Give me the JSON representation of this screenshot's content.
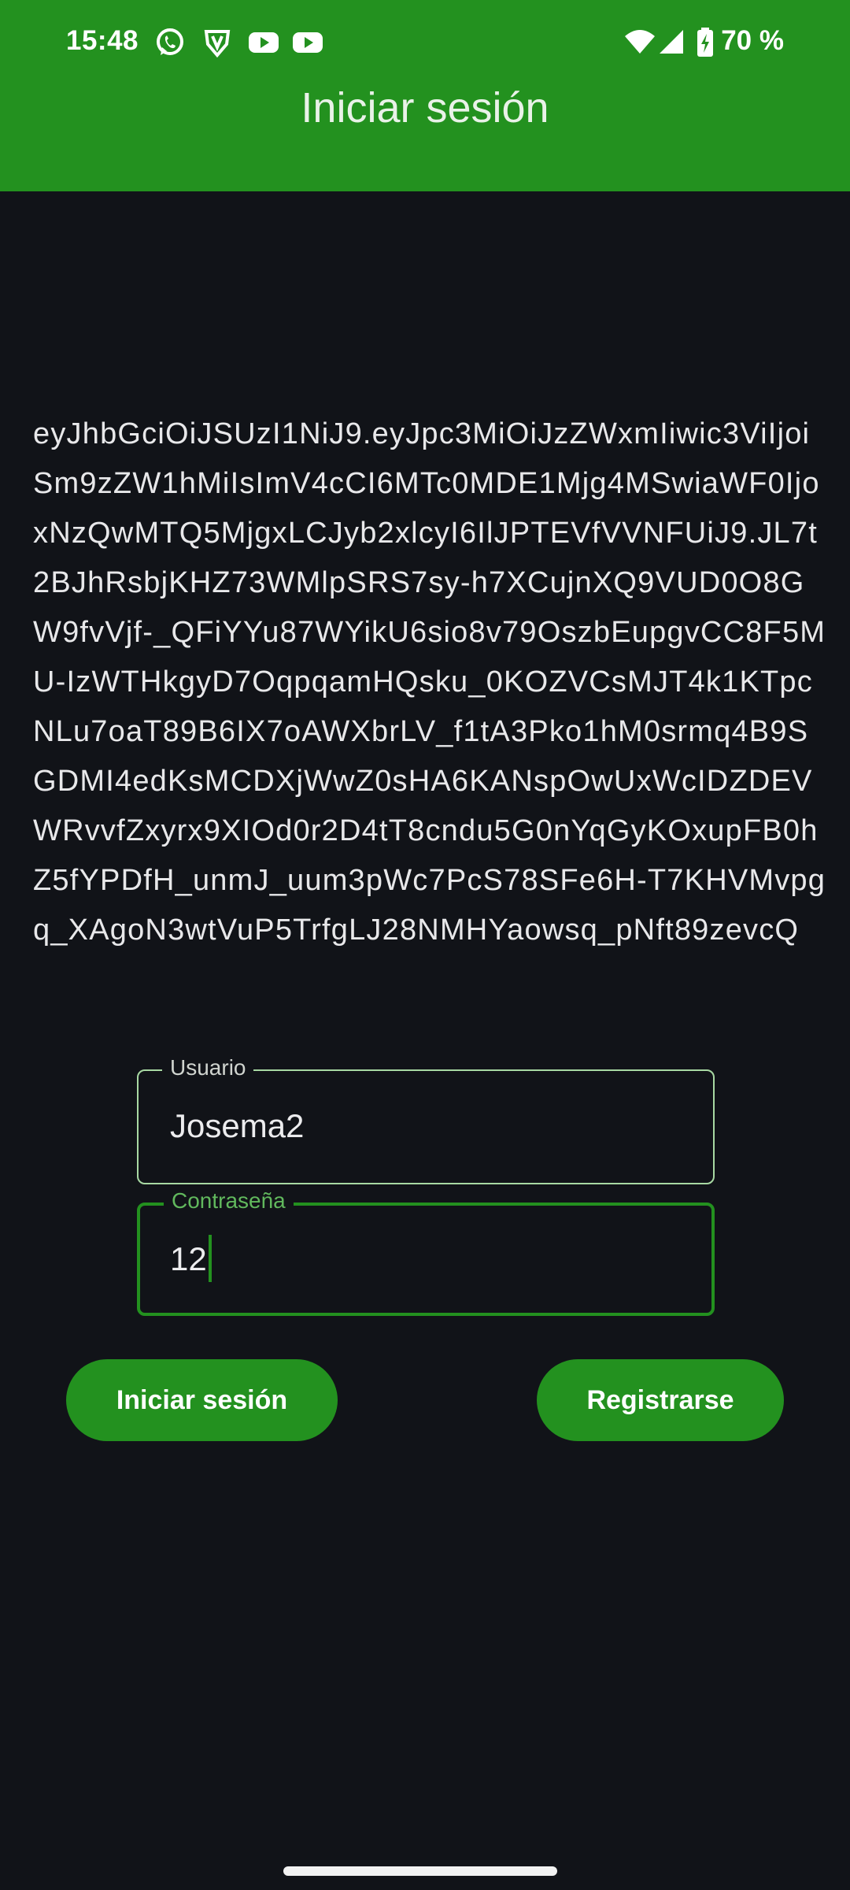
{
  "status_bar": {
    "time": "15:48",
    "battery": "70 %",
    "icons": [
      "whatsapp-icon",
      "vpn-shield-icon",
      "youtube-icon",
      "youtube-icon",
      "wifi-icon",
      "signal-icon",
      "battery-charging-icon"
    ]
  },
  "app_bar": {
    "title": "Iniciar sesión"
  },
  "token_text": "eyJhbGciOiJSUzI1NiJ9.eyJpc3MiOiJzZWxmIiwic3ViIjoiSm9zZW1hMiIsImV4cCI6MTc0MDE1Mjg4MSwiaWF0IjoxNzQwMTQ5MjgxLCJyb2xlcyI6IlJPTEVfVVNFUiJ9.JL7t2BJhRsbjKHZ73WMlpSRS7sy-h7XCujnXQ9VUD0O8GW9fvVjf-_QFiYYu87WYikU6sio8v79OszbEupgvCC8F5MU-IzWTHkgyD7OqpqamHQsku_0KOZVCsMJT4k1KTpcNLu7oaT89B6IX7oAWXbrLV_f1tA3Pko1hM0srmq4B9SGDMI4edKsMCDXjWwZ0sHA6KANspOwUxWcIDZDEVWRvvfZxyrx9XIOd0r2D4tT8cndu5G0nYqGyKOxupFB0hZ5fYPDfH_unmJ_uum3pWc7PcS78SFe6H-T7KHVMvpgq_XAgoN3wtVuP5TrfgLJ28NMHYaowsq_pNft89zevcQ",
  "form": {
    "username": {
      "label": "Usuario",
      "value": "Josema2"
    },
    "password": {
      "label": "Contraseña",
      "value": "12"
    }
  },
  "buttons": {
    "login_label": "Iniciar sesión",
    "register_label": "Registrarse"
  },
  "colors": {
    "primary": "#23911f",
    "background": "#111318",
    "text": "#e8e8ea"
  }
}
